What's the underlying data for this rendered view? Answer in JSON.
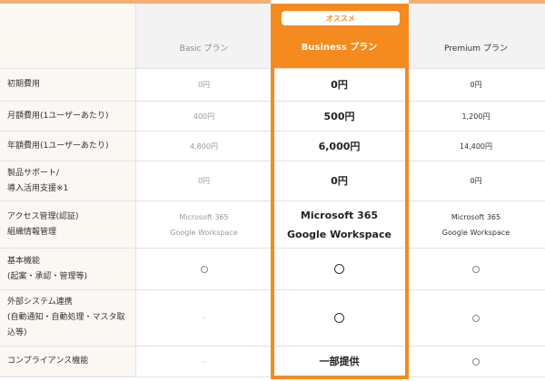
{
  "badge": "オススメ",
  "plans": [
    "Basic プラン",
    "Business プラン",
    "Premium プラン"
  ],
  "rows": [
    {
      "label": [
        "初期費用"
      ],
      "basic": "0円",
      "business": "0円",
      "premium": "0円"
    },
    {
      "label": [
        "月額費用(1ユーザーあたり)"
      ],
      "basic": "400円",
      "business": "500円",
      "premium": "1,200円"
    },
    {
      "label": [
        "年額費用(1ユーザーあたり)"
      ],
      "basic": "4,800円",
      "business": "6,000円",
      "premium": "14,400円"
    },
    {
      "label": [
        "製品サポート/",
        "導入活用支援※1"
      ],
      "basic": "0円",
      "business": "0円",
      "premium": "0円"
    },
    {
      "label": [
        "アクセス管理(認証)",
        "組織情報管理"
      ],
      "basic": [
        "Microsoft 365",
        "Google Workspace"
      ],
      "business": [
        "Microsoft 365",
        "Google Workspace"
      ],
      "premium": [
        "Microsoft 365",
        "Google Workspace"
      ]
    },
    {
      "label": [
        "基本機能",
        "(起案・承認・管理等)"
      ],
      "basic": "◯",
      "business": "◯",
      "premium": "◯"
    },
    {
      "label": [
        "外部システム連携",
        "(自動通知・自動処理・マスタ取",
        "込等)"
      ],
      "basic": "-",
      "business": "◯",
      "premium": "◯"
    },
    {
      "label": [
        "コンプライアンス機能"
      ],
      "basic": "-",
      "business": "一部提供",
      "premium": "◯"
    }
  ],
  "colors": {
    "accent": "#f58a1f",
    "label_bg": "#fbf7f3",
    "header_bg": "#f3f3f3"
  }
}
